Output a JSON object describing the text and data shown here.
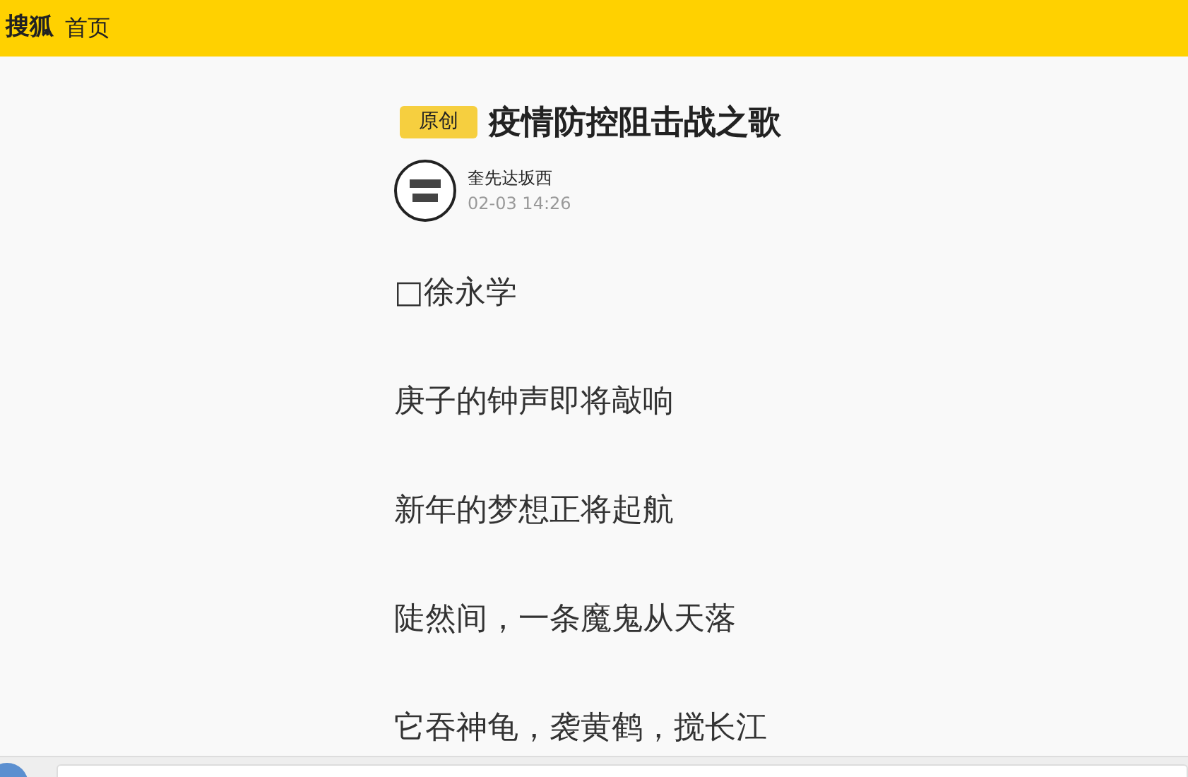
{
  "header": {
    "logo": "搜狐",
    "home_link": "首页"
  },
  "article": {
    "badge": "原创",
    "title": "疫情防控阻击战之歌",
    "author": {
      "name": "奎先达坂西",
      "time": "02-03 14:26"
    },
    "paragraphs": [
      "□徐永学",
      "庚子的钟声即将敲响",
      "新年的梦想正将起航",
      "陡然间，一条魔鬼从天落",
      "它吞神龟，袭黄鹤，搅长江"
    ]
  },
  "bottom_bar": {
    "kind": "comment-bar"
  }
}
